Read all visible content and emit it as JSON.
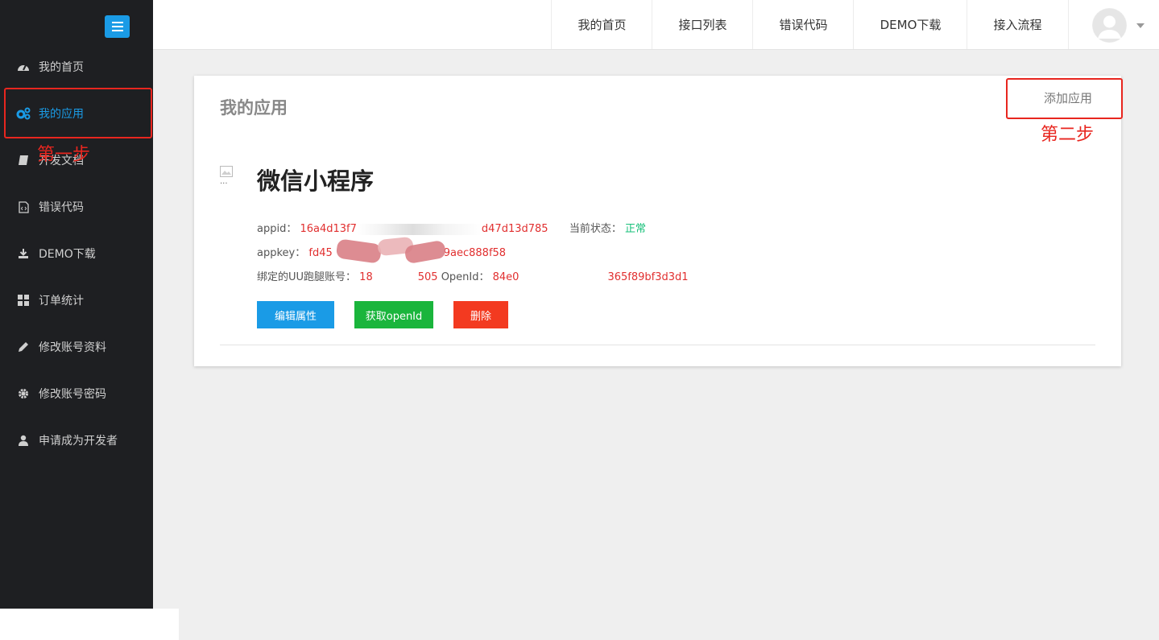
{
  "sidebar": {
    "items": [
      {
        "label": "我的首页",
        "icon": "dashboard-icon"
      },
      {
        "label": "我的应用",
        "icon": "cogs-icon"
      },
      {
        "label": "开发文档",
        "icon": "book-icon"
      },
      {
        "label": "错误代码",
        "icon": "file-code-icon"
      },
      {
        "label": "DEMO下载",
        "icon": "download-icon"
      },
      {
        "label": "订单统计",
        "icon": "grid-icon"
      },
      {
        "label": "修改账号资料",
        "icon": "pencil-icon"
      },
      {
        "label": "修改账号密码",
        "icon": "gear-icon"
      },
      {
        "label": "申请成为开发者",
        "icon": "user-icon"
      }
    ],
    "active": "我的应用"
  },
  "topnav": {
    "items": [
      "我的首页",
      "接口列表",
      "错误代码",
      "DEMO下载",
      "接入流程"
    ]
  },
  "page": {
    "title": "我的应用",
    "add_label": "添加应用"
  },
  "app": {
    "image_alt": "...",
    "name": "微信小程序",
    "appid_label": "appid：",
    "appid_prefix": "16a4d13f7",
    "appid_suffix": "d47d13d785",
    "status_label": "当前状态：",
    "status_value": "正常",
    "appkey_label": "appkey：",
    "appkey_prefix": "fd45",
    "appkey_suffix": "9aec888f58",
    "uu_label": "绑定的UU跑腿账号：",
    "uu_prefix": "18",
    "uu_suffix": "505",
    "openid_label": "OpenId：",
    "openid_prefix": "84e0",
    "openid_suffix": "365f89bf3d3d1",
    "buttons": {
      "edit": "编辑属性",
      "get_openid": "获取openId",
      "delete": "删除"
    }
  },
  "annotations": {
    "step1": "第一步",
    "step2": "第二步"
  },
  "colors": {
    "sidebar_bg": "#1e1f22",
    "accent_blue": "#1a9be6",
    "edit_button": "#1a9be6",
    "openid_button": "#1ab53c",
    "delete_button": "#f33a20",
    "annotation_red": "#e8261f"
  }
}
